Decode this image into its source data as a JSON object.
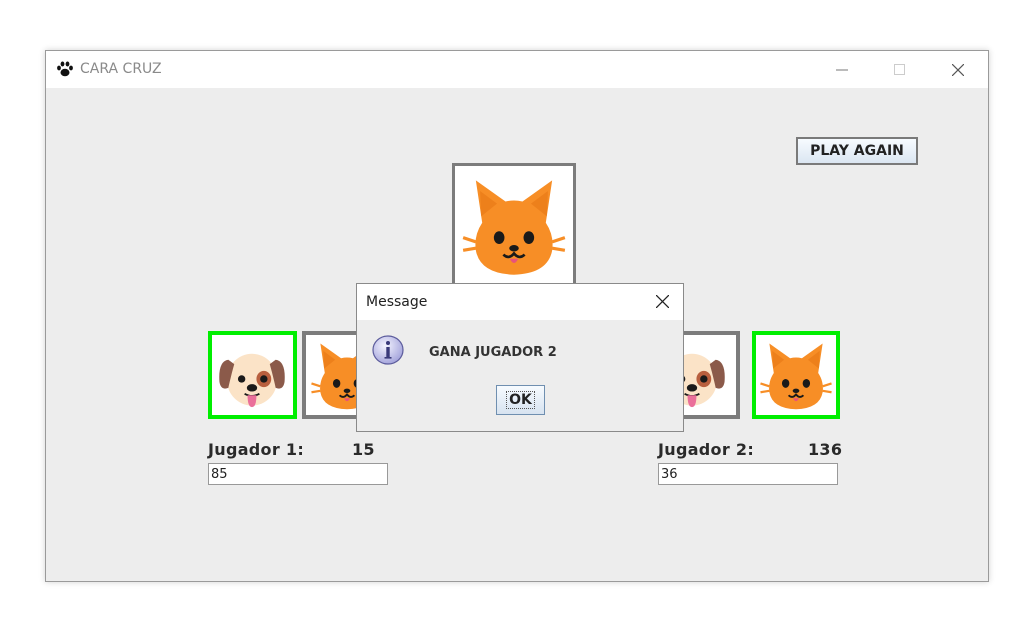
{
  "window": {
    "title": "CARA CRUZ",
    "icon": "paw-icon",
    "controls": [
      "minimize-icon",
      "maximize-icon",
      "close-icon"
    ]
  },
  "toolbar": {
    "play_again_label": "PLAY AGAIN"
  },
  "center_card": {
    "face": "cat",
    "icon": "cat-face-icon"
  },
  "player1": {
    "label": "Jugador 1:",
    "score": "15",
    "input_value": "85",
    "cards": [
      {
        "face": "dog",
        "icon": "dog-face-icon",
        "selected": true
      },
      {
        "face": "cat",
        "icon": "cat-face-icon",
        "selected": false
      }
    ]
  },
  "player2": {
    "label": "Jugador 2:",
    "score": "136",
    "input_value": "36",
    "cards": [
      {
        "face": "dog",
        "icon": "dog-face-icon",
        "selected": false
      },
      {
        "face": "cat",
        "icon": "cat-face-icon",
        "selected": true
      }
    ]
  },
  "dialog": {
    "title": "Message",
    "icon": "info-icon",
    "message": "GANA JUGADOR 2",
    "ok_label": "OK"
  },
  "colors": {
    "selected_border": "#00ee00",
    "unselected_border": "#7c7c7c",
    "cat_orange": "#f78e26",
    "window_bg": "#ededed"
  }
}
